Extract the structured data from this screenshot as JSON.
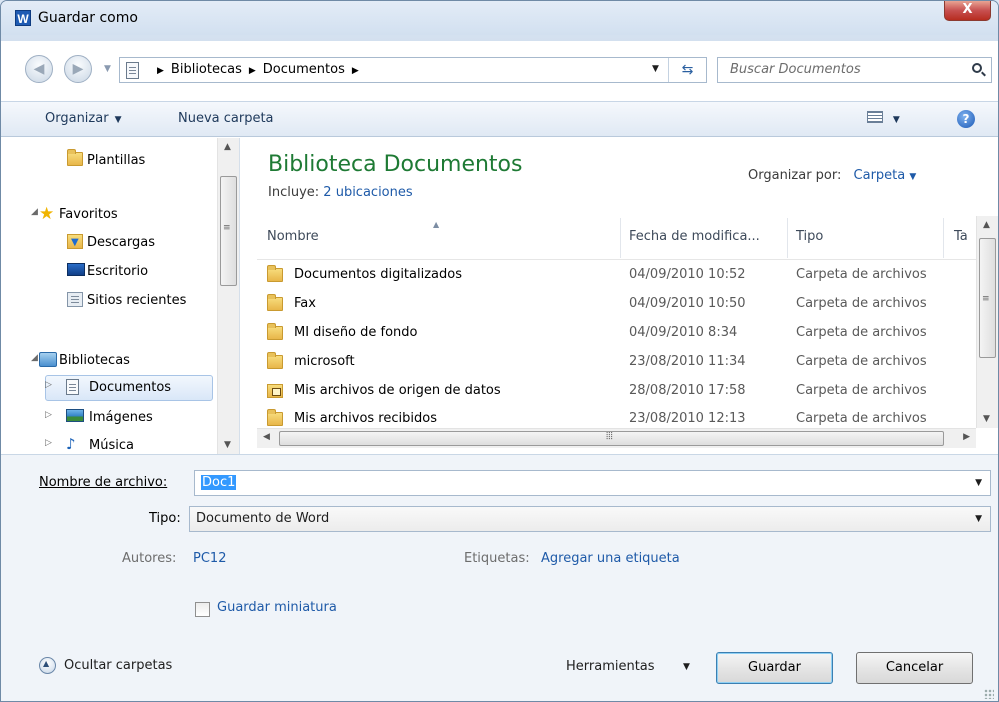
{
  "window": {
    "title": "Guardar como",
    "app_icon": "W",
    "close_label": "X"
  },
  "address": {
    "crumbs": [
      "Bibliotecas",
      "Documentos"
    ],
    "search_placeholder": "Buscar Documentos"
  },
  "toolbar": {
    "organize_label": "Organizar",
    "new_folder_label": "Nueva carpeta"
  },
  "navpane": {
    "items": [
      {
        "label": "Plantillas",
        "icon": "folder-icon"
      },
      {
        "label": "Favoritos",
        "icon": "star-icon"
      },
      {
        "label": "Descargas",
        "icon": "download-icon"
      },
      {
        "label": "Escritorio",
        "icon": "desktop-icon"
      },
      {
        "label": "Sitios recientes",
        "icon": "recent-places-icon"
      },
      {
        "label": "Bibliotecas",
        "icon": "library-icon"
      },
      {
        "label": "Documentos",
        "icon": "document-icon"
      },
      {
        "label": "Imágenes",
        "icon": "image-icon"
      },
      {
        "label": "Música",
        "icon": "music-icon"
      }
    ]
  },
  "library": {
    "title": "Biblioteca Documentos",
    "includes_prefix": "Incluye:",
    "includes_link": "2 ubicaciones",
    "arrange_label": "Organizar por:",
    "arrange_value": "Carpeta"
  },
  "columns": {
    "name": "Nombre",
    "date": "Fecha de modifica...",
    "type": "Tipo",
    "size": "Ta"
  },
  "files": [
    {
      "name": "Documentos digitalizados",
      "date": "04/09/2010 10:52",
      "type": "Carpeta de archivos",
      "icon": "folder-icon"
    },
    {
      "name": "Fax",
      "date": "04/09/2010 10:50",
      "type": "Carpeta de archivos",
      "icon": "folder-icon"
    },
    {
      "name": "MI diseño de fondo",
      "date": "04/09/2010 8:34",
      "type": "Carpeta de archivos",
      "icon": "folder-icon"
    },
    {
      "name": "microsoft",
      "date": "23/08/2010 11:34",
      "type": "Carpeta de archivos",
      "icon": "folder-icon"
    },
    {
      "name": "Mis archivos de origen de datos",
      "date": "28/08/2010 17:58",
      "type": "Carpeta de archivos",
      "icon": "data-source-folder-icon"
    },
    {
      "name": "Mis archivos recibidos",
      "date": "23/08/2010 12:13",
      "type": "Carpeta de archivos",
      "icon": "folder-icon"
    }
  ],
  "form": {
    "filename_label": "Nombre de archivo:",
    "filename_value": "Doc1",
    "type_label": "Tipo:",
    "type_value": "Documento de Word",
    "authors_label": "Autores:",
    "authors_value": "PC12",
    "tags_label": "Etiquetas:",
    "tags_value": "Agregar una etiqueta",
    "thumbnail_label": "Guardar miniatura",
    "thumbnail_checked": false
  },
  "footer": {
    "hide_folders_label": "Ocultar carpetas",
    "tools_label": "Herramientas",
    "save_label": "Guardar",
    "cancel_label": "Cancelar"
  }
}
